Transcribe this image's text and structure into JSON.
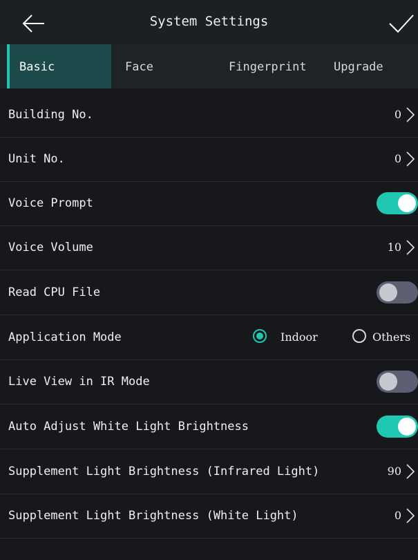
{
  "header": {
    "title": "System Settings",
    "back_icon": "arrow-left-icon",
    "confirm_icon": "checkmark-icon"
  },
  "tabs": [
    {
      "label": "Basic",
      "active": true
    },
    {
      "label": "Face",
      "active": false
    },
    {
      "label": "Fingerprint",
      "active": false
    },
    {
      "label": "Upgrade",
      "active": false
    }
  ],
  "settings": {
    "building_no": {
      "label": "Building No.",
      "value": "0"
    },
    "unit_no": {
      "label": "Unit No.",
      "value": "0"
    },
    "voice_prompt": {
      "label": "Voice Prompt",
      "enabled": true
    },
    "voice_volume": {
      "label": "Voice Volume",
      "value": "10"
    },
    "read_cpu_file": {
      "label": "Read CPU File",
      "enabled": false
    },
    "application_mode": {
      "label": "Application Mode",
      "options": [
        {
          "label": "Indoor",
          "selected": true
        },
        {
          "label": "Others",
          "selected": false
        }
      ]
    },
    "live_view_ir": {
      "label": "Live View in IR Mode",
      "enabled": false
    },
    "auto_adjust_white": {
      "label": "Auto Adjust White Light Brightness",
      "enabled": true
    },
    "supplement_ir": {
      "label": "Supplement Light Brightness (Infrared Light)",
      "value": "90"
    },
    "supplement_white": {
      "label": "Supplement Light Brightness (White Light)",
      "value": "0"
    }
  },
  "colors": {
    "accent": "#20c8b2",
    "background": "#16181c",
    "active_tab": "#1d4a4b",
    "toggle_off": "#5c6072"
  }
}
